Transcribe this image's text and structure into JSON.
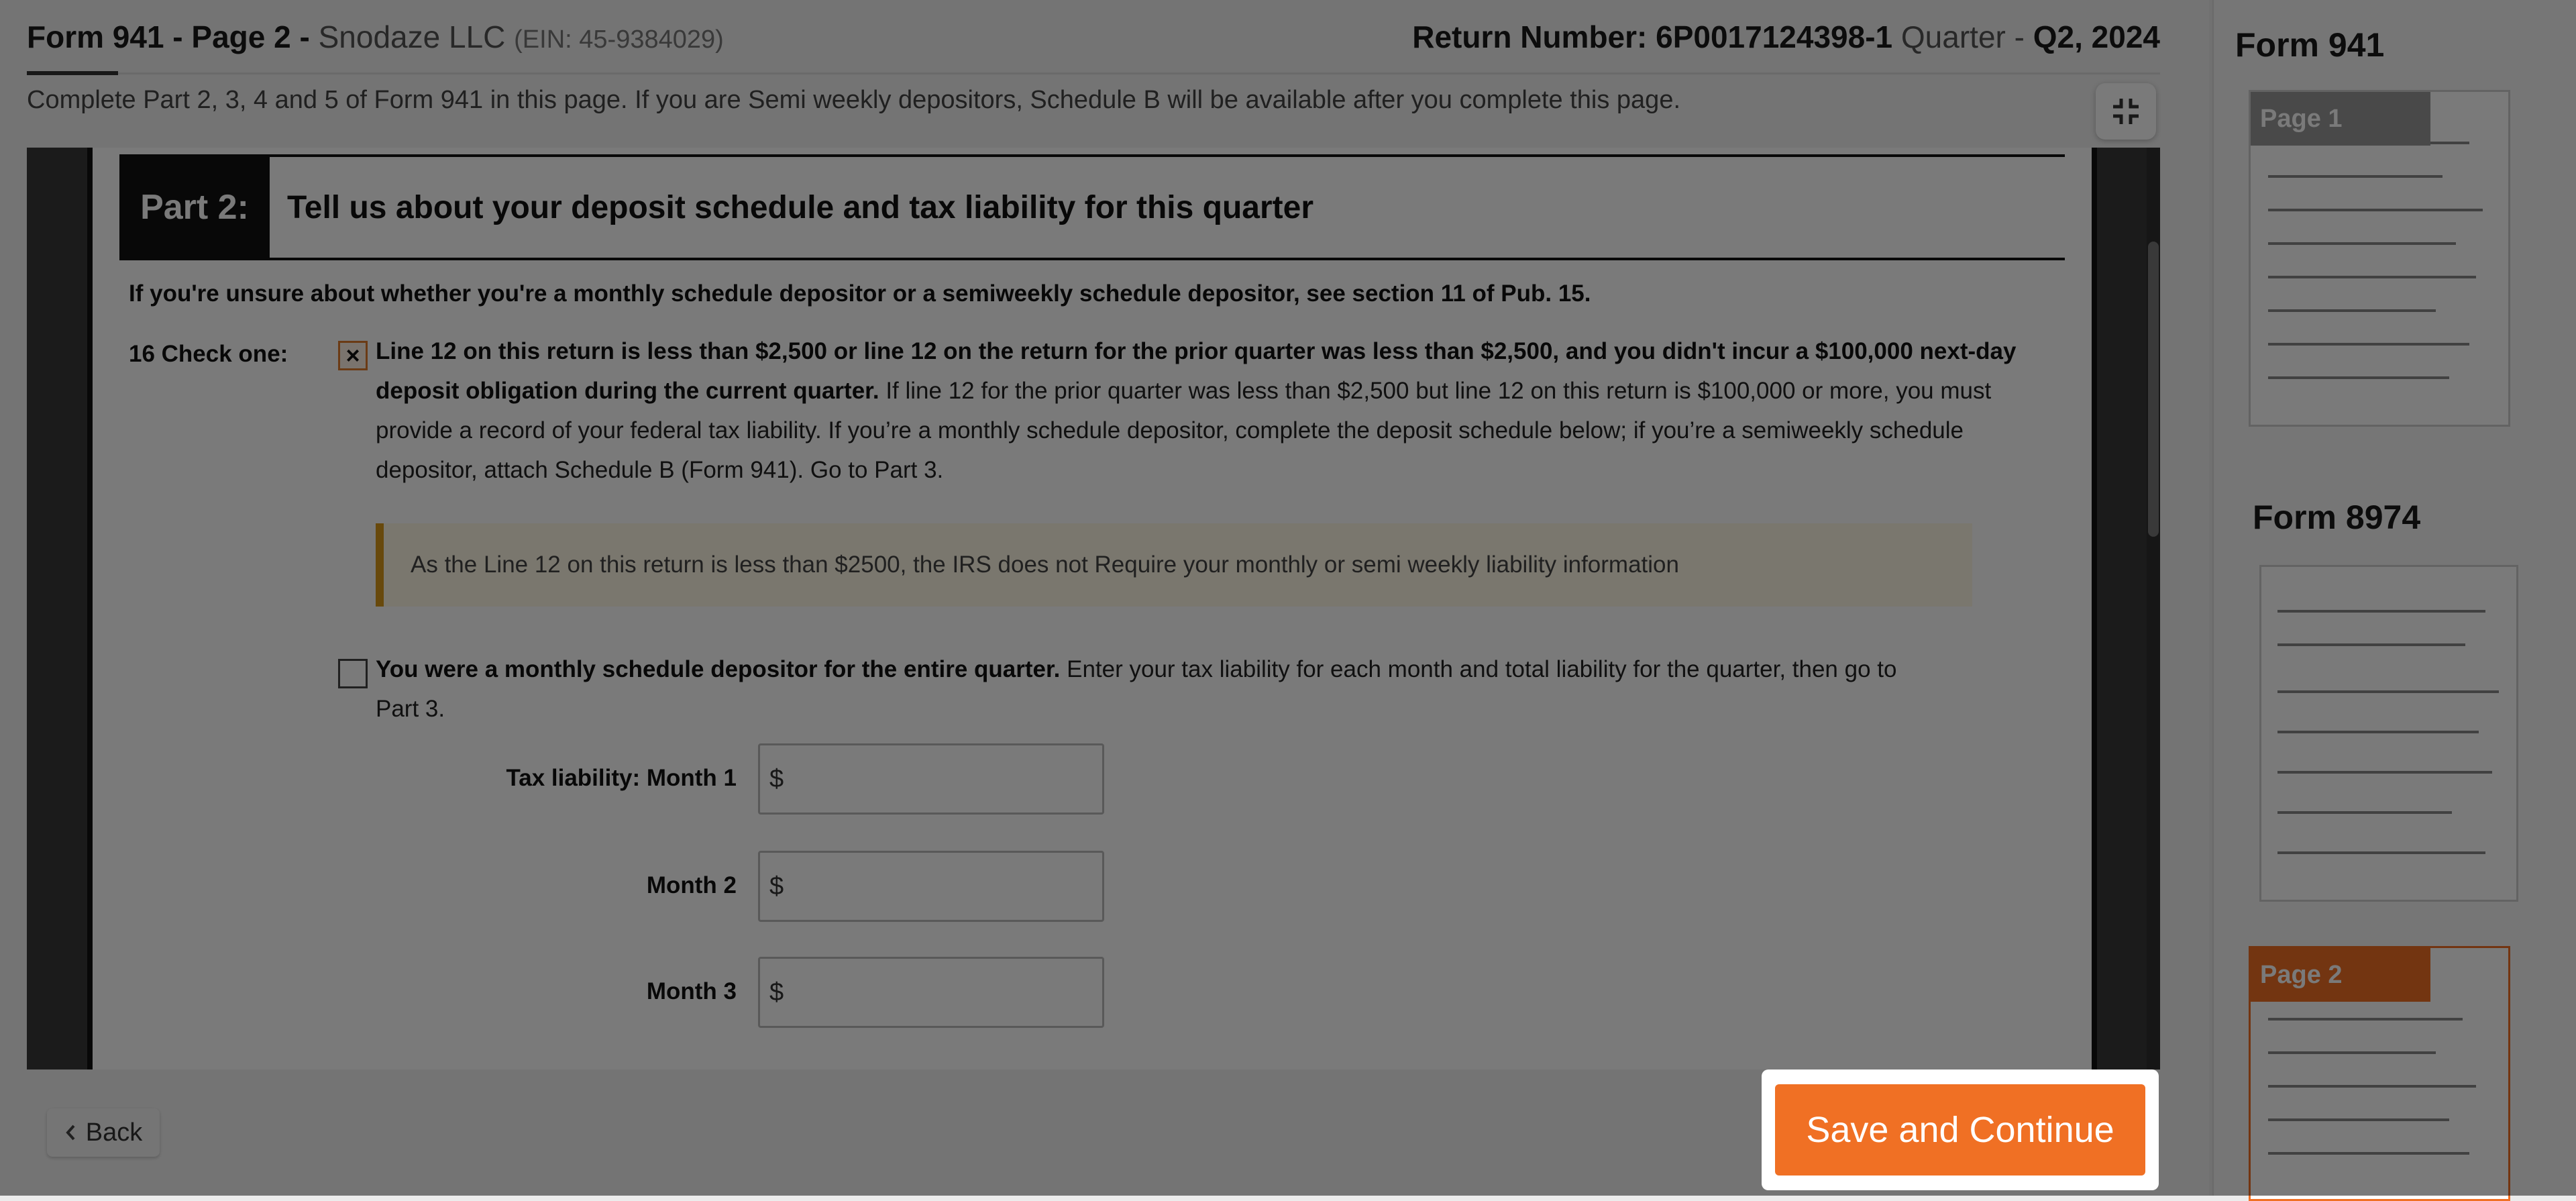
{
  "header": {
    "form_title": "Form 941 - Page 2 -",
    "company": "Snodaze LLC",
    "ein": "(EIN: 45-9384029)",
    "return_label": "Return Number:",
    "return_number": "6P0017124398-1",
    "quarter_label": "Quarter -",
    "quarter_value": "Q2, 2024"
  },
  "subtitle": "Complete Part 2, 3, 4 and 5 of Form 941 in this page. If you are Semi weekly depositors, Schedule B will be available after you complete this page.",
  "part2": {
    "label": "Part 2:",
    "title": "Tell us about your deposit schedule and tax liability for this quarter",
    "unsure_note": "If you're unsure about whether you're a monthly schedule depositor or a semiweekly schedule depositor, see section 11 of Pub. 15.",
    "q16_label": "16  Check one:",
    "option1": {
      "checked_mark": "×",
      "bold": "Line 12 on this return is less than $2,500 or line 12 on the return for the prior quarter was less than $2,500, and you didn't incur a $100,000 next-day deposit obligation during the current quarter.",
      "text": " If line 12 for the prior quarter was less than $2,500 but line 12 on this return is $100,000 or more, you must provide a record of your federal tax liability. If you’re a monthly schedule depositor, complete the deposit schedule below; if you’re a semiweekly schedule depositor, attach Schedule B (Form 941). Go to Part 3."
    },
    "notice": "As the Line 12 on this return is less than $2500, the IRS does not Require your monthly or semi weekly liability information",
    "option2": {
      "bold": "You were a monthly schedule depositor for the entire quarter.",
      "text": " Enter your tax liability for each month and total liability for the quarter, then go to Part 3."
    },
    "fields": {
      "month1_label": "Tax liability: Month 1",
      "month2_label": "Month 2",
      "month3_label": "Month 3",
      "currency": "$",
      "month1_value": "",
      "month2_value": "",
      "month3_value": ""
    }
  },
  "footer": {
    "back_label": "Back",
    "save_label": "Save and Continue"
  },
  "sidebar": {
    "form941_title": "Form 941",
    "page1_badge": "Page 1",
    "form8974_title": "Form 8974",
    "page2_badge": "Page 2"
  },
  "colors": {
    "accent": "#f07024",
    "notice_border": "#d99a1a"
  },
  "icons": {
    "collapse": "collapse-icon",
    "back": "chevron-left-icon"
  }
}
